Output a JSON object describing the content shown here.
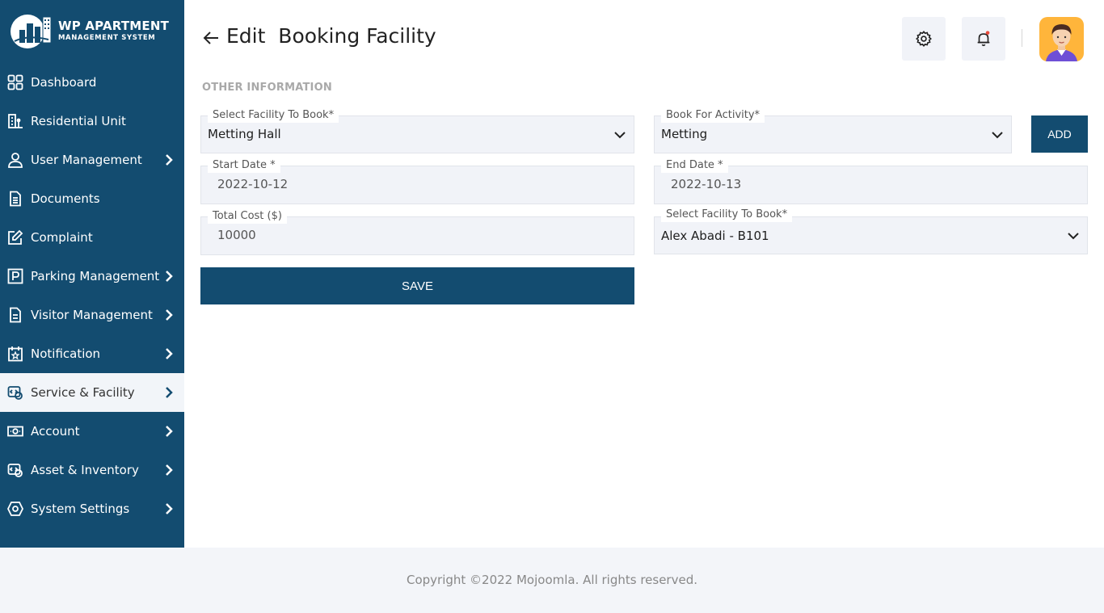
{
  "app": {
    "logo_title": "WP APARTMENT",
    "logo_subtitle": "MANAGEMENT SYSTEM"
  },
  "sidebar": {
    "items": [
      {
        "label": "Dashboard",
        "icon": "dashboard-icon",
        "has_submenu": false
      },
      {
        "label": "Residential Unit",
        "icon": "building-icon",
        "has_submenu": false
      },
      {
        "label": "User Management",
        "icon": "user-icon",
        "has_submenu": true
      },
      {
        "label": "Documents",
        "icon": "document-icon",
        "has_submenu": false
      },
      {
        "label": "Complaint",
        "icon": "edit-icon",
        "has_submenu": false
      },
      {
        "label": "Parking Management",
        "icon": "parking-icon",
        "has_submenu": true
      },
      {
        "label": "Visitor Management",
        "icon": "file-list-icon",
        "has_submenu": true
      },
      {
        "label": "Notification",
        "icon": "calendar-star-icon",
        "has_submenu": true
      },
      {
        "label": "Service & Facility",
        "icon": "service-icon",
        "has_submenu": true,
        "active": true
      },
      {
        "label": "Account",
        "icon": "money-icon",
        "has_submenu": true
      },
      {
        "label": "Asset & Inventory",
        "icon": "asset-icon",
        "has_submenu": true
      },
      {
        "label": "System Settings",
        "icon": "settings-eye-icon",
        "has_submenu": true
      }
    ]
  },
  "header": {
    "title": "Edit  Booking Facility",
    "icons": [
      "back-arrow-icon",
      "gear-icon",
      "bell-icon"
    ]
  },
  "form": {
    "section_title": "OTHER INFORMATION",
    "facility": {
      "label": "Select Facility To Book*",
      "value": "Metting Hall"
    },
    "activity": {
      "label": "Book For Activity*",
      "value": "Metting"
    },
    "start_date": {
      "label": "Start Date *",
      "value": "2022-10-12"
    },
    "end_date": {
      "label": "End Date *",
      "value": "2022-10-13"
    },
    "total_cost": {
      "label": "Total Cost ($)",
      "value": "10000"
    },
    "member": {
      "label": "Select Facility To Book*",
      "value": "Alex Abadi - B101"
    },
    "add_label": "ADD",
    "save_label": "SAVE"
  },
  "footer": {
    "copyright": "Copyright ©2022 Mojoomla. All rights reserved."
  },
  "colors": {
    "primary": "#134c70",
    "field_bg": "#f1f3f8",
    "active_bg": "#f2f5f9",
    "notification_dot": "#e94b3c",
    "avatar_bg": "#ffb53b"
  }
}
